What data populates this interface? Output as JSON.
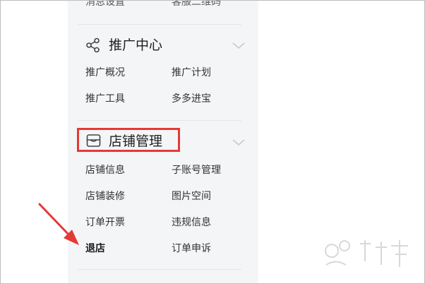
{
  "menu": {
    "top_row": {
      "left": "消息设置",
      "right": "客服二维码"
    },
    "promo": {
      "title": "推广中心",
      "items": [
        "推广概况",
        "推广计划",
        "推广工具",
        "多多进宝"
      ]
    },
    "store": {
      "title": "店铺管理",
      "items": [
        "店铺信息",
        "子账号管理",
        "店铺装修",
        "图片空间",
        "订单开票",
        "违规信息",
        "退店",
        "订单申诉"
      ]
    }
  },
  "icons": {
    "promo_icon": "share-icon",
    "store_icon": "store-icon",
    "chevron": "chevron-down-icon"
  },
  "colors": {
    "sidebar_bg": "#f4f5f7",
    "highlight": "#e53935",
    "arrow": "#e53935"
  }
}
